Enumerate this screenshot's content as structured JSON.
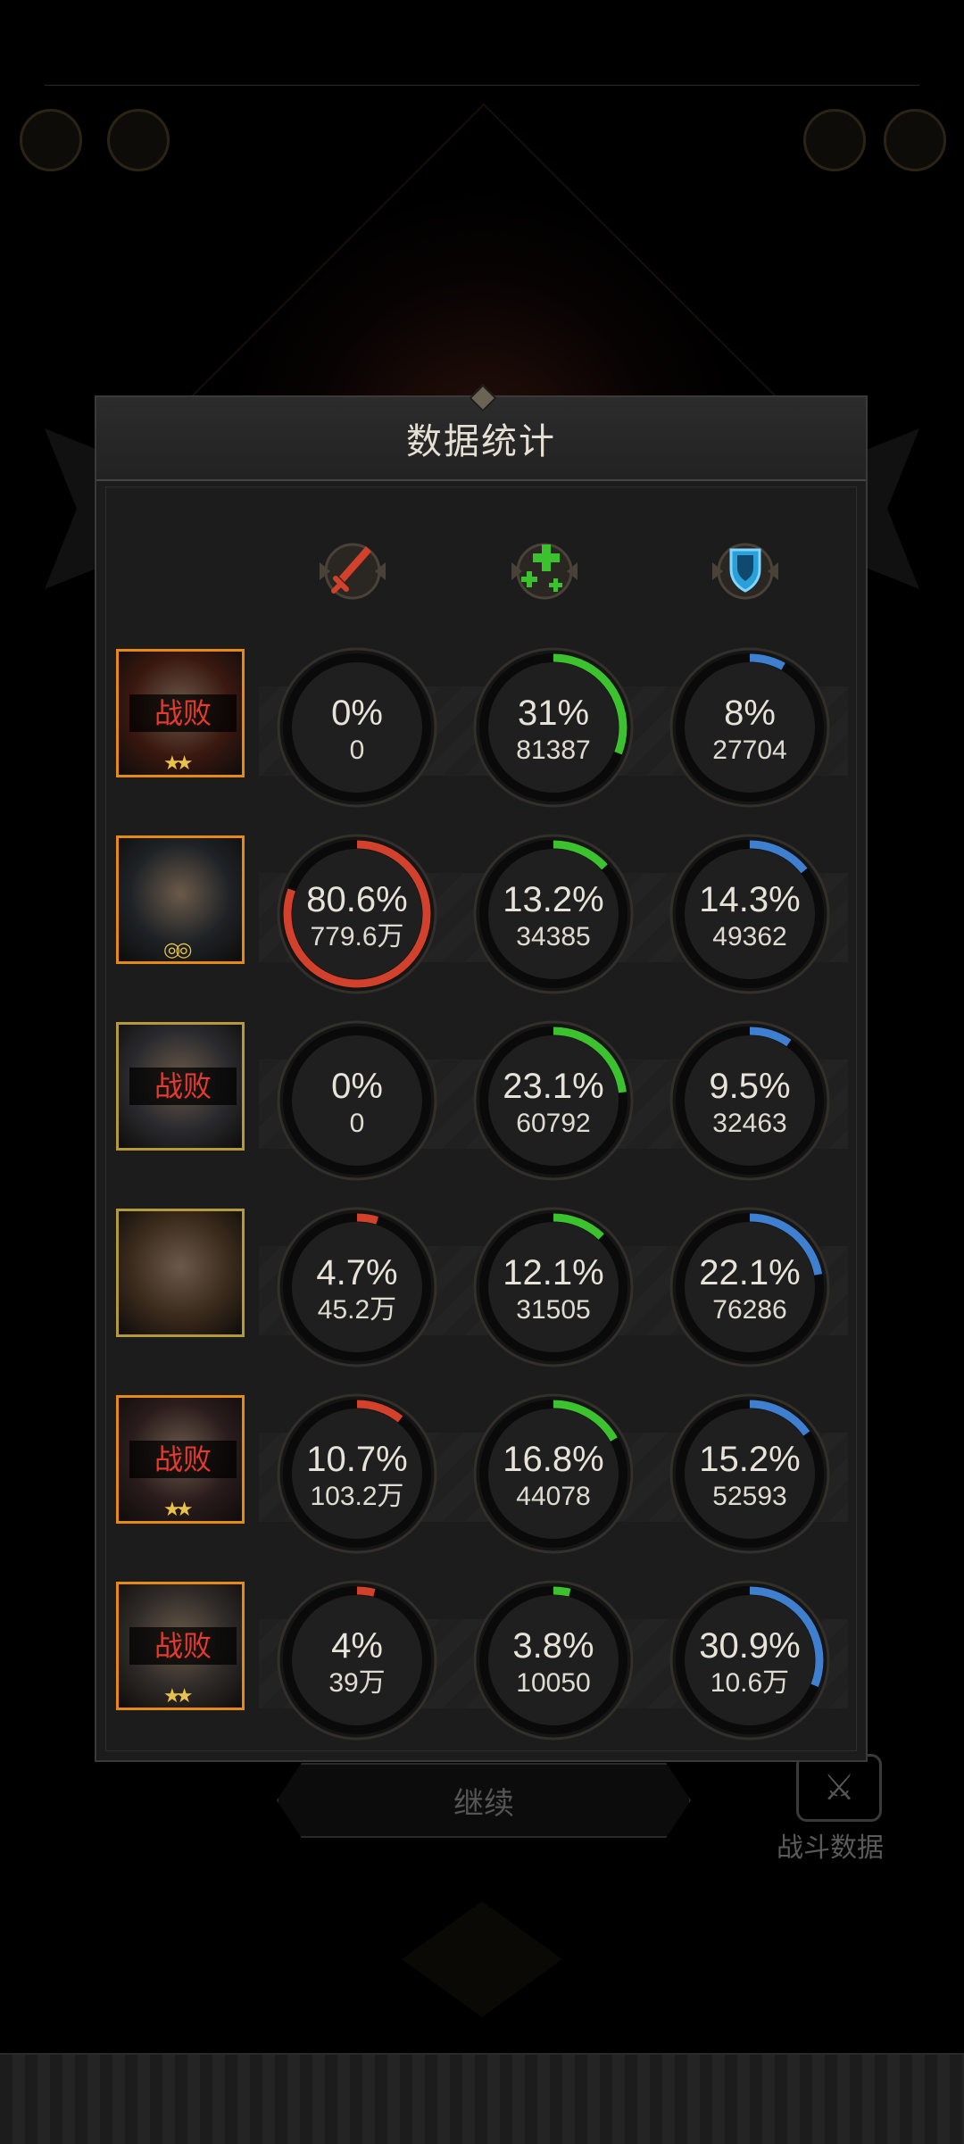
{
  "panel": {
    "title": "数据统计"
  },
  "columns": [
    {
      "icon": "red-sword-damage-icon",
      "color": "#d2412c"
    },
    {
      "icon": "green-healing-crosses-icon",
      "color": "#3cc22e"
    },
    {
      "icon": "blue-shield-defense-icon",
      "color": "#3f7fd0"
    }
  ],
  "rows": [
    {
      "hero": "hero-1",
      "defeated_label": "战败",
      "badge": "★★",
      "damage": {
        "pct": "0%",
        "value": "0",
        "ratio": 0
      },
      "heal": {
        "pct": "31%",
        "value": "81387",
        "ratio": 0.31
      },
      "tank": {
        "pct": "8%",
        "value": "27704",
        "ratio": 0.08
      }
    },
    {
      "hero": "hero-2",
      "defeated_label": "",
      "badge": "◎◎",
      "damage": {
        "pct": "80.6%",
        "value": "779.6万",
        "ratio": 0.806
      },
      "heal": {
        "pct": "13.2%",
        "value": "34385",
        "ratio": 0.132
      },
      "tank": {
        "pct": "14.3%",
        "value": "49362",
        "ratio": 0.143
      }
    },
    {
      "hero": "hero-3",
      "defeated_label": "战败",
      "badge": "",
      "damage": {
        "pct": "0%",
        "value": "0",
        "ratio": 0
      },
      "heal": {
        "pct": "23.1%",
        "value": "60792",
        "ratio": 0.231
      },
      "tank": {
        "pct": "9.5%",
        "value": "32463",
        "ratio": 0.095
      }
    },
    {
      "hero": "hero-4",
      "defeated_label": "",
      "badge": "",
      "damage": {
        "pct": "4.7%",
        "value": "45.2万",
        "ratio": 0.047
      },
      "heal": {
        "pct": "12.1%",
        "value": "31505",
        "ratio": 0.121
      },
      "tank": {
        "pct": "22.1%",
        "value": "76286",
        "ratio": 0.221
      }
    },
    {
      "hero": "hero-5",
      "defeated_label": "战败",
      "badge": "★★",
      "damage": {
        "pct": "10.7%",
        "value": "103.2万",
        "ratio": 0.107
      },
      "heal": {
        "pct": "16.8%",
        "value": "44078",
        "ratio": 0.168
      },
      "tank": {
        "pct": "15.2%",
        "value": "52593",
        "ratio": 0.152
      }
    },
    {
      "hero": "hero-6",
      "defeated_label": "战败",
      "badge": "★★",
      "damage": {
        "pct": "4%",
        "value": "39万",
        "ratio": 0.04
      },
      "heal": {
        "pct": "3.8%",
        "value": "10050",
        "ratio": 0.038
      },
      "tank": {
        "pct": "30.9%",
        "value": "10.6万",
        "ratio": 0.309
      }
    }
  ],
  "footer": {
    "continue_label": "继续",
    "battle_data_label": "战斗数据"
  }
}
